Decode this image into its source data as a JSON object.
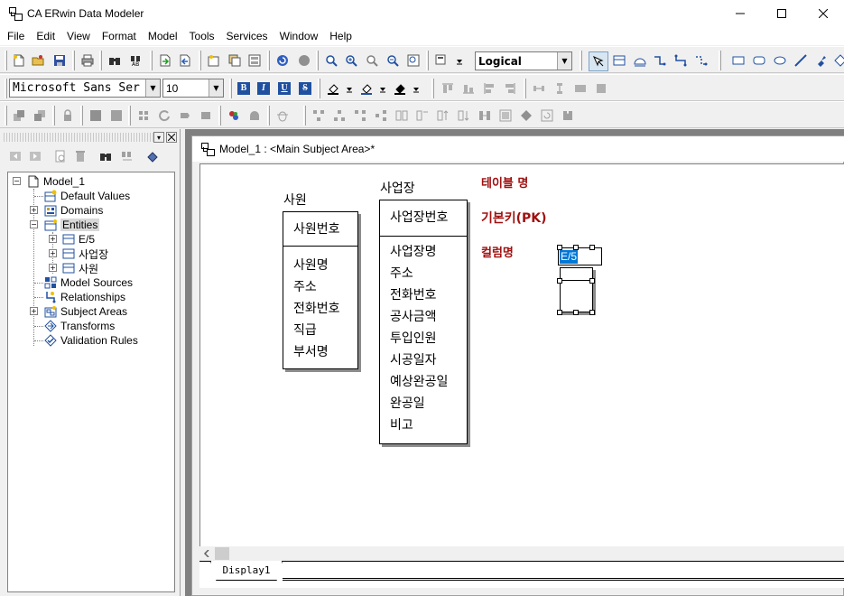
{
  "window": {
    "title": "CA ERwin Data Modeler"
  },
  "window_controls": {
    "minimize": "—",
    "maximize": "☐",
    "close": "✕"
  },
  "menu": [
    "File",
    "Edit",
    "View",
    "Format",
    "Model",
    "Tools",
    "Services",
    "Window",
    "Help"
  ],
  "toolbar": {
    "view_mode": "Logical",
    "font_name": "Microsoft Sans Ser",
    "font_size": "10",
    "bold": "B",
    "italic": "I",
    "underline": "U",
    "strikeout": "S"
  },
  "model_explorer": {
    "items": [
      {
        "label": "Model_1"
      },
      {
        "label": "Default Values"
      },
      {
        "label": "Domains"
      },
      {
        "label": "Entities"
      },
      {
        "label": "E/5"
      },
      {
        "label": "사업장"
      },
      {
        "label": "사원"
      },
      {
        "label": "Model Sources"
      },
      {
        "label": "Relationships"
      },
      {
        "label": "Subject Areas"
      },
      {
        "label": "Transforms"
      },
      {
        "label": "Validation Rules"
      }
    ]
  },
  "diagram_window": {
    "title": "Model_1 : <Main Subject Area>*",
    "tab": "Display1"
  },
  "diagram": {
    "entities": [
      {
        "name": "사원",
        "primary_key": [
          "사원번호"
        ],
        "attributes": [
          "사원명",
          "주소",
          "전화번호",
          "직급",
          "부서명"
        ]
      },
      {
        "name": "사업장",
        "primary_key": [
          "사업장번호"
        ],
        "attributes": [
          "사업장명",
          "주소",
          "전화번호",
          "공사금액",
          "투입인원",
          "시공일자",
          "예상완공일",
          "완공일",
          "비고"
        ]
      }
    ],
    "legend": {
      "table_name": "테이블 명",
      "primary_key": "기본키(PK)",
      "column_name": "컬럼명"
    },
    "new_entity": {
      "name": "E/5"
    }
  }
}
